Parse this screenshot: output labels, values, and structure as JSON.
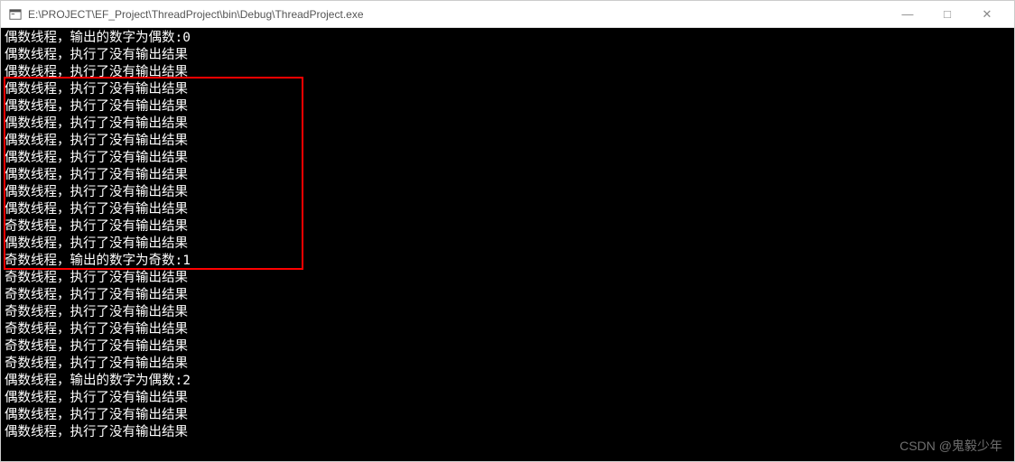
{
  "window": {
    "title": "E:\\PROJECT\\EF_Project\\ThreadProject\\bin\\Debug\\ThreadProject.exe",
    "minimize": "—",
    "maximize": "□",
    "close": "✕"
  },
  "console": {
    "lines": [
      "偶数线程，输出的数字为偶数:0",
      "偶数线程，执行了没有输出结果",
      "偶数线程，执行了没有输出结果",
      "偶数线程，执行了没有输出结果",
      "偶数线程，执行了没有输出结果",
      "偶数线程，执行了没有输出结果",
      "偶数线程，执行了没有输出结果",
      "偶数线程，执行了没有输出结果",
      "偶数线程，执行了没有输出结果",
      "偶数线程，执行了没有输出结果",
      "偶数线程，执行了没有输出结果",
      "奇数线程，执行了没有输出结果",
      "偶数线程，执行了没有输出结果",
      "奇数线程，输出的数字为奇数:1",
      "奇数线程，执行了没有输出结果",
      "奇数线程，执行了没有输出结果",
      "奇数线程，执行了没有输出结果",
      "奇数线程，执行了没有输出结果",
      "奇数线程，执行了没有输出结果",
      "奇数线程，执行了没有输出结果",
      "偶数线程，输出的数字为偶数:2",
      "偶数线程，执行了没有输出结果",
      "偶数线程，执行了没有输出结果",
      "偶数线程，执行了没有输出结果"
    ]
  },
  "watermark": "CSDN @鬼毅少年"
}
